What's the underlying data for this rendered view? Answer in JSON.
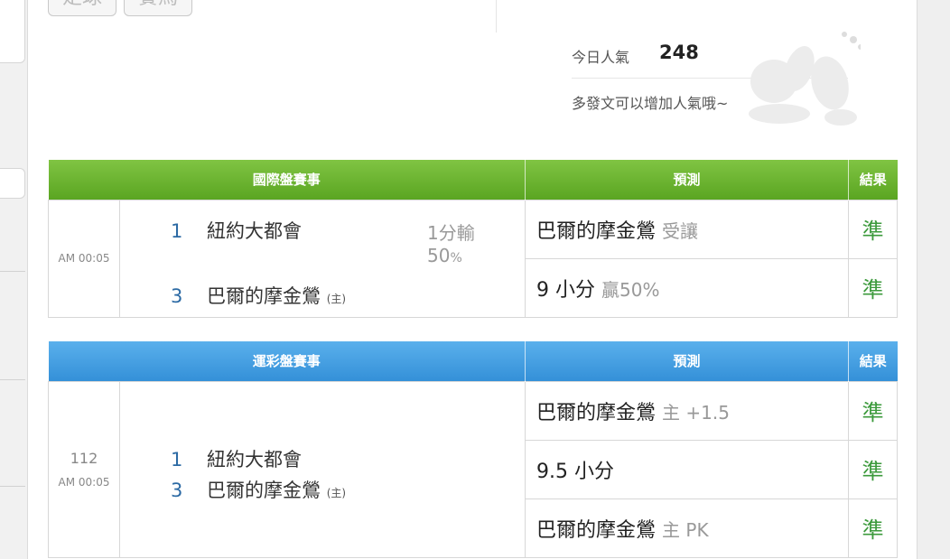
{
  "top_chips": [
    "足球",
    "賽馬"
  ],
  "popularity": {
    "label": "今日人氣",
    "count": "248",
    "tip": "多發文可以增加人氣哦~"
  },
  "international": {
    "headers": [
      "國際盤賽事",
      "預測",
      "結果"
    ],
    "time": "AM 00:05",
    "teams": [
      {
        "no": "1",
        "name": "紐約大都會",
        "tag": ""
      },
      {
        "no": "3",
        "name": "巴爾的摩金鶯",
        "tag": "(主)"
      }
    ],
    "handicap": {
      "line": "1分輸",
      "pct": "50",
      "pct_unit": "%"
    },
    "predictions": [
      {
        "main": "巴爾的摩金鶯",
        "sub": "受讓",
        "result": "準"
      },
      {
        "main": "9 小分",
        "sub": "贏50%",
        "result": "準"
      }
    ]
  },
  "lottery": {
    "headers": [
      "運彩盤賽事",
      "預測",
      "結果"
    ],
    "game_no": "112",
    "time": "AM 00:05",
    "teams": [
      {
        "no": "1",
        "name": "紐約大都會",
        "tag": ""
      },
      {
        "no": "3",
        "name": "巴爾的摩金鶯",
        "tag": "(主)"
      }
    ],
    "predictions": [
      {
        "main": "巴爾的摩金鶯",
        "sub": "主 +1.5",
        "result": "準"
      },
      {
        "main": "9.5 小分",
        "sub": "",
        "result": "準"
      },
      {
        "main": "巴爾的摩金鶯",
        "sub": "主 PK",
        "result": "準"
      }
    ]
  },
  "colors": {
    "international_header": "#6db531",
    "lottery_header": "#45a0e2",
    "result_text": "#3c9a3c",
    "team_number": "#2c6aa4"
  }
}
